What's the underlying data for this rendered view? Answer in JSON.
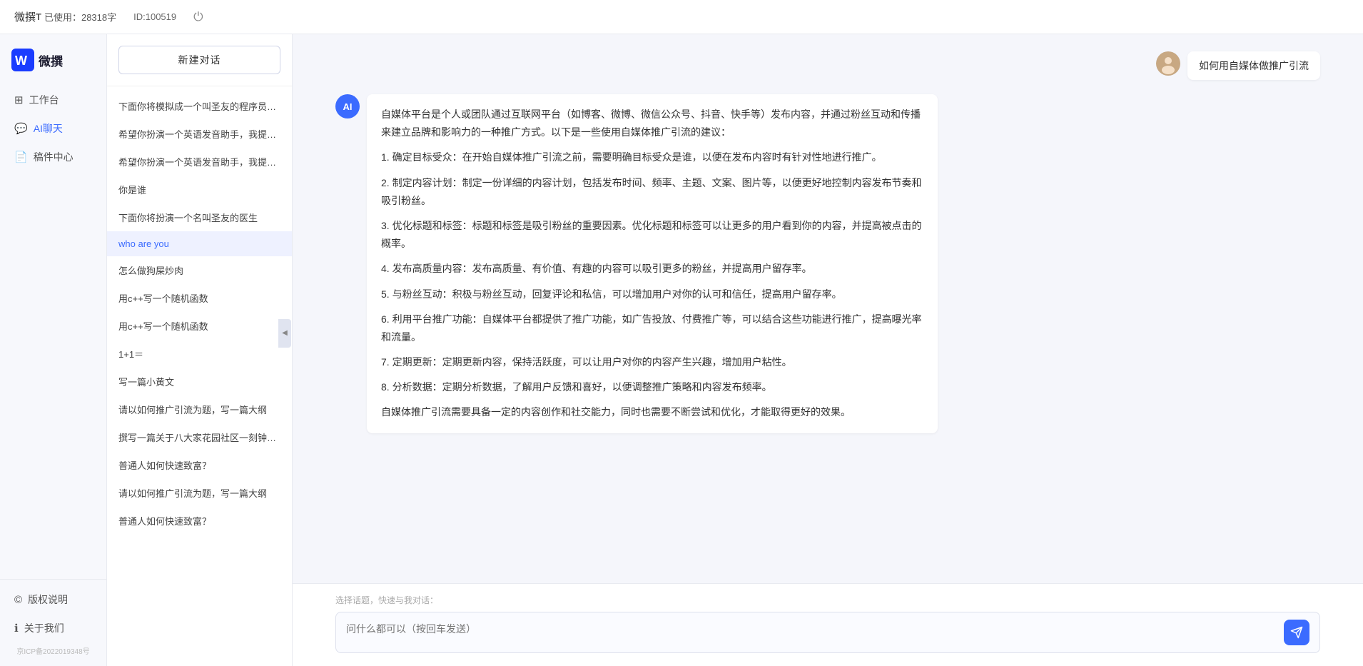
{
  "topbar": {
    "title": "微撰",
    "usage_label": "已使用：28318字",
    "id_label": "ID:100519",
    "char_icon": "T"
  },
  "logo": {
    "text": "微撰"
  },
  "nav": {
    "items": [
      {
        "id": "workbench",
        "label": "工作台",
        "icon": "⊞"
      },
      {
        "id": "ai-chat",
        "label": "AI聊天",
        "icon": "💬"
      },
      {
        "id": "mailbox",
        "label": "稿件中心",
        "icon": "📄"
      }
    ],
    "bottom_items": [
      {
        "id": "copyright",
        "label": "版权说明",
        "icon": "©"
      },
      {
        "id": "about",
        "label": "关于我们",
        "icon": "ℹ"
      }
    ],
    "icp": "京ICP备2022019348号"
  },
  "sidebar": {
    "new_chat_label": "新建对话",
    "chat_items": [
      {
        "id": 1,
        "text": "下面你将模拟成一个叫圣友的程序员，我说..."
      },
      {
        "id": 2,
        "text": "希望你扮演一个英语发音助手，我提供给你..."
      },
      {
        "id": 3,
        "text": "希望你扮演一个英语发音助手，我提供给你..."
      },
      {
        "id": 4,
        "text": "你是谁"
      },
      {
        "id": 5,
        "text": "下面你将扮演一个名叫圣友的医生"
      },
      {
        "id": 6,
        "text": "who are you"
      },
      {
        "id": 7,
        "text": "怎么做狗屎炒肉"
      },
      {
        "id": 8,
        "text": "用c++写一个随机函数"
      },
      {
        "id": 9,
        "text": "用c++写一个随机函数"
      },
      {
        "id": 10,
        "text": "1+1＝"
      },
      {
        "id": 11,
        "text": "写一篇小黄文"
      },
      {
        "id": 12,
        "text": "请以如何推广引流为题，写一篇大纲"
      },
      {
        "id": 13,
        "text": "撰写一篇关于八大家花园社区一刻钟便民生..."
      },
      {
        "id": 14,
        "text": "普通人如何快速致富？"
      },
      {
        "id": 15,
        "text": "请以如何推广引流为题，写一篇大纲"
      },
      {
        "id": 16,
        "text": "普通人如何快速致富？"
      }
    ]
  },
  "chat": {
    "user_question": "如何用自媒体做推广引流",
    "ai_response_paragraphs": [
      "自媒体平台是个人或团队通过互联网平台（如博客、微博、微信公众号、抖音、快手等）发布内容，并通过粉丝互动和传播来建立品牌和影响力的一种推广方式。以下是一些使用自媒体推广引流的建议：",
      "1. 确定目标受众：在开始自媒体推广引流之前，需要明确目标受众是谁，以便在发布内容时有针对性地进行推广。",
      "2. 制定内容计划：制定一份详细的内容计划，包括发布时间、频率、主题、文案、图片等，以便更好地控制内容发布节奏和吸引粉丝。",
      "3. 优化标题和标签：标题和标签是吸引粉丝的重要因素。优化标题和标签可以让更多的用户看到你的内容，并提高被点击的概率。",
      "4. 发布高质量内容：发布高质量、有价值、有趣的内容可以吸引更多的粉丝，并提高用户留存率。",
      "5. 与粉丝互动：积极与粉丝互动，回复评论和私信，可以增加用户对你的认可和信任，提高用户留存率。",
      "6. 利用平台推广功能：自媒体平台都提供了推广功能，如广告投放、付费推广等，可以结合这些功能进行推广，提高曝光率和流量。",
      "7. 定期更新：定期更新内容，保持活跃度，可以让用户对你的内容产生兴趣，增加用户粘性。",
      "8. 分析数据：定期分析数据，了解用户反馈和喜好，以便调整推广策略和内容发布频率。",
      "自媒体推广引流需要具备一定的内容创作和社交能力，同时也需要不断尝试和优化，才能取得更好的效果。"
    ]
  },
  "input": {
    "quick_label": "选择话题，快速与我对话：",
    "placeholder": "问什么都可以（按回车发送）"
  },
  "collapse_icon": "◀"
}
